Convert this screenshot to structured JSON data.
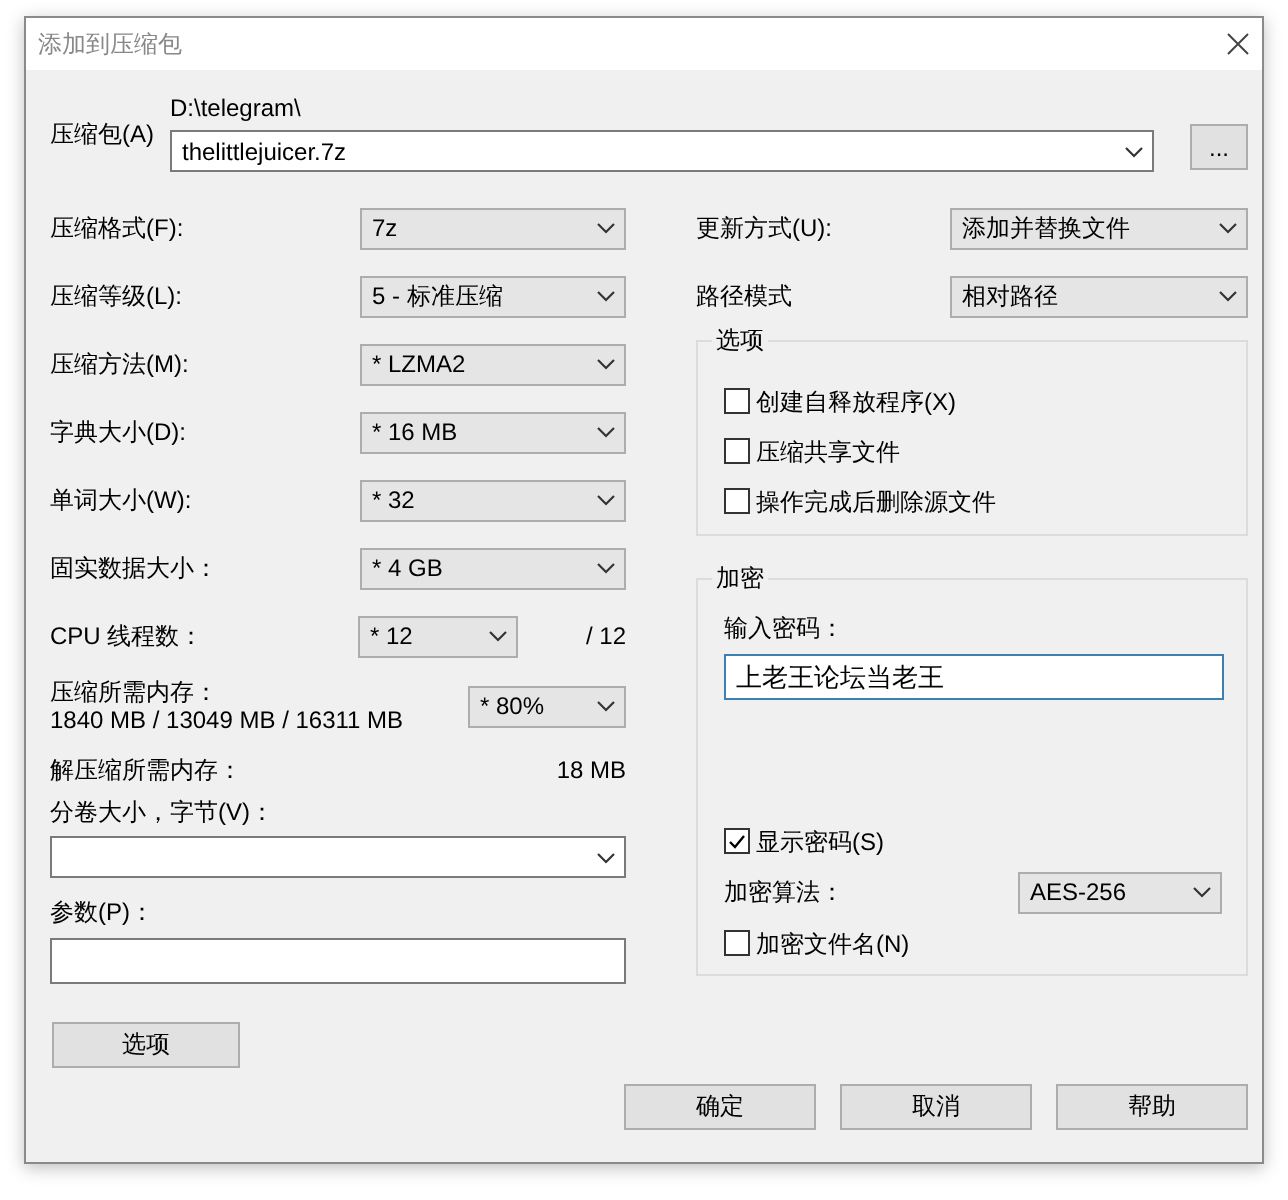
{
  "window": {
    "title": "添加到压缩包"
  },
  "archive": {
    "label": "压缩包(A)",
    "path": "D:\\telegram\\",
    "value": "thelittlejuicer.7z"
  },
  "browse_button": "...",
  "settings": [
    {
      "label": "压缩格式(F):",
      "value": "7z"
    },
    {
      "label": "压缩等级(L):",
      "value": "5 - 标准压缩"
    },
    {
      "label": "压缩方法(M):",
      "value": "* LZMA2"
    },
    {
      "label": "字典大小(D):",
      "value": "* 16 MB"
    },
    {
      "label": "单词大小(W):",
      "value": "* 32"
    },
    {
      "label": "固实数据大小：",
      "value": "* 4 GB"
    }
  ],
  "threads": {
    "label": "CPU 线程数：",
    "value": "* 12",
    "max": "/ 12"
  },
  "memory": {
    "label": "压缩所需内存：",
    "detail": "1840 MB / 13049 MB / 16311 MB",
    "value": "* 80%"
  },
  "decompress_memory": {
    "label": "解压缩所需内存：",
    "value": "18 MB"
  },
  "volume": {
    "label": "分卷大小，字节(V)："
  },
  "parameters": {
    "label": "参数(P)："
  },
  "options_button": "选项",
  "update_mode": {
    "label": "更新方式(U):",
    "value": "添加并替换文件"
  },
  "path_mode": {
    "label": "路径模式",
    "value": "相对路径"
  },
  "options": {
    "title": "选项",
    "items": [
      {
        "label": "创建自释放程序(X)",
        "checked": false
      },
      {
        "label": "压缩共享文件",
        "checked": false
      },
      {
        "label": "操作完成后删除源文件",
        "checked": false
      }
    ]
  },
  "encryption": {
    "title": "加密",
    "password_label": "输入密码：",
    "password": "上老王论坛当老王",
    "show_password": {
      "label": "显示密码(S)",
      "checked": true
    },
    "method_label": "加密算法：",
    "method": "AES-256",
    "encrypt_names": {
      "label": "加密文件名(N)",
      "checked": false
    }
  },
  "buttons": [
    "确定",
    "取消",
    "帮助"
  ]
}
